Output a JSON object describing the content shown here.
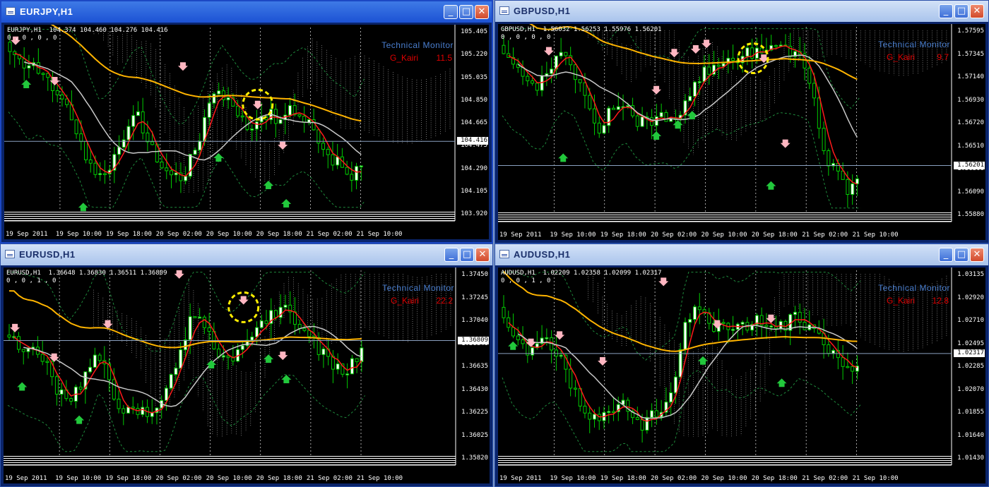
{
  "colors": {
    "bull": "#ffffff",
    "bear": "#00cc00",
    "wick": "#00cc00",
    "tenkan": "#ff1a1a",
    "kijun": "#c8c8c8",
    "sma": "#ffb400",
    "cloud": "#ffffff",
    "bands": "#1e8a3c",
    "up_arrow": "#22c83c",
    "down_arrow": "#ffb6c1",
    "highlight_circle": "#ffee00"
  },
  "labels": {
    "technical_monitor": "Technical Monitor",
    "g_kairi": "G_Kairi"
  },
  "windows": [
    {
      "title": "EURJPY,H1",
      "active": true,
      "ohlc": "EURJPY,H1  104.374 104.460 104.276 104.416",
      "params": "0 , 0 , 0 , 0",
      "g_kairi_value": "11.5",
      "current_price": "104.416",
      "price_labels": [
        "105.405",
        "105.220",
        "105.035",
        "104.850",
        "104.665",
        "104.475",
        "104.290",
        "104.105",
        "103.920"
      ],
      "time_labels": [
        "19 Sep 2011",
        "19 Sep 10:00",
        "19 Sep 18:00",
        "20 Sep 02:00",
        "20 Sep 10:00",
        "20 Sep 18:00",
        "21 Sep 02:00",
        "21 Sep 10:00"
      ],
      "icon": "chart-window-icon"
    },
    {
      "title": "GBPUSD,H1",
      "active": false,
      "ohlc": "GBPUSD,H1  1.56032 1.56253 1.55976 1.56201",
      "params": "0 , 0 , 0 , 0",
      "g_kairi_value": "9.7",
      "current_price": "1.56201",
      "price_labels": [
        "1.57595",
        "1.57345",
        "1.57140",
        "1.56930",
        "1.56720",
        "1.56510",
        "1.56300",
        "1.56090",
        "1.55880"
      ],
      "time_labels": [
        "19 Sep 2011",
        "19 Sep 10:00",
        "19 Sep 18:00",
        "20 Sep 02:00",
        "20 Sep 10:00",
        "20 Sep 18:00",
        "21 Sep 02:00",
        "21 Sep 10:00"
      ],
      "icon": "chart-window-icon"
    },
    {
      "title": "EURUSD,H1",
      "active": false,
      "ohlc": "EURUSD,H1  1.36648 1.36830 1.36511 1.36809",
      "params": "0 , 0 , 1 , 0",
      "g_kairi_value": "22.2",
      "current_price": "1.36809",
      "price_labels": [
        "1.37450",
        "1.37245",
        "1.37040",
        "1.36840",
        "1.36635",
        "1.36430",
        "1.36225",
        "1.36025",
        "1.35820"
      ],
      "time_labels": [
        "19 Sep 2011",
        "19 Sep 10:00",
        "19 Sep 18:00",
        "20 Sep 02:00",
        "20 Sep 10:00",
        "20 Sep 18:00",
        "21 Sep 02:00",
        "21 Sep 10:00"
      ],
      "icon": "chart-window-icon"
    },
    {
      "title": "AUDUSD,H1",
      "active": false,
      "ohlc": "AUDUSD,H1  1.02209 1.02358 1.02099 1.02317",
      "params": "0 , 0 , 1 , 0",
      "g_kairi_value": "12.8",
      "current_price": "1.02317",
      "price_labels": [
        "1.03135",
        "1.02920",
        "1.02710",
        "1.02495",
        "1.02285",
        "1.02070",
        "1.01855",
        "1.01640",
        "1.01430"
      ],
      "time_labels": [
        "19 Sep 2011",
        "19 Sep 10:00",
        "19 Sep 18:00",
        "20 Sep 02:00",
        "20 Sep 10:00",
        "20 Sep 18:00",
        "21 Sep 02:00",
        "21 Sep 10:00"
      ],
      "icon": "chart-window-icon"
    }
  ],
  "window_buttons": {
    "minimize": "_",
    "maximize": "□",
    "close": "✕"
  }
}
